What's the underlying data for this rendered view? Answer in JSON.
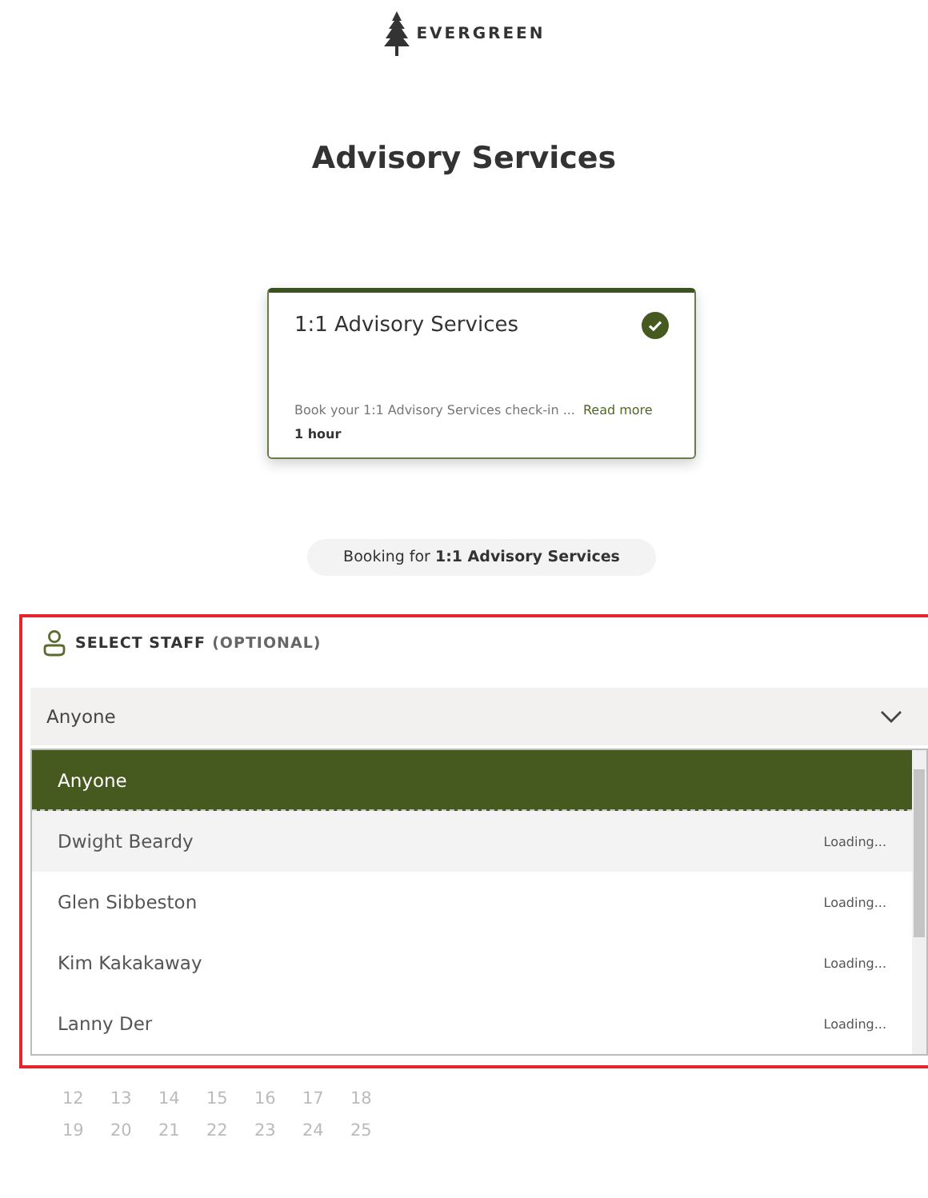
{
  "brand": {
    "name": "EVERGREEN"
  },
  "title": "Advisory Services",
  "service_card": {
    "title": "1:1 Advisory Services",
    "selected": true,
    "description": "Book your 1:1 Advisory Services check-in ...",
    "read_more": "Read more",
    "duration": "1 hour"
  },
  "booking_for": {
    "label": "Booking for",
    "service": "1:1 Advisory Services"
  },
  "staff_section": {
    "heading": "SELECT STAFF",
    "heading_note": "(OPTIONAL)",
    "select_value": "Anyone",
    "options": [
      {
        "name": "Anyone",
        "selected": true,
        "hovered": false
      },
      {
        "name": "Dwight Beardy",
        "status": "Loading...",
        "selected": false,
        "hovered": true
      },
      {
        "name": "Glen Sibbeston",
        "status": "Loading...",
        "selected": false,
        "hovered": false
      },
      {
        "name": "Kim Kakakaway",
        "status": "Loading...",
        "selected": false,
        "hovered": false
      },
      {
        "name": "Lanny Der",
        "status": "Loading...",
        "selected": false,
        "hovered": false
      }
    ]
  },
  "calendar": {
    "weeks": [
      [
        "12",
        "13",
        "14",
        "15",
        "16",
        "17",
        "18"
      ],
      [
        "19",
        "20",
        "21",
        "22",
        "23",
        "24",
        "25"
      ]
    ]
  }
}
